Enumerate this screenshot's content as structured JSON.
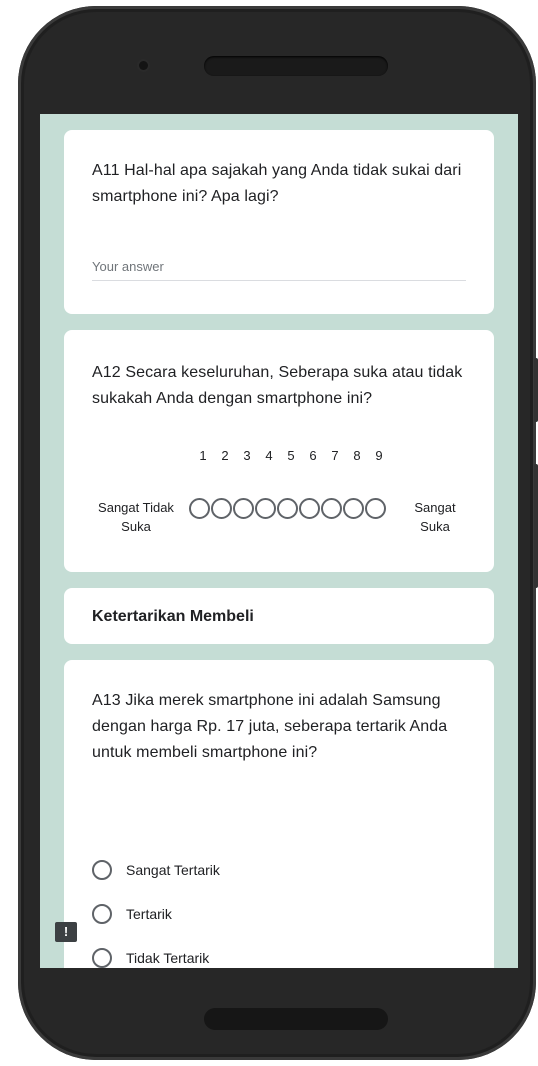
{
  "form": {
    "q11": {
      "title": "A11 Hal-hal apa sajakah yang Anda tidak sukai dari smartphone ini? Apa lagi?",
      "placeholder": "Your answer"
    },
    "q12": {
      "title": "A12 Secara keseluruhan, Seberapa suka atau tidak sukakah Anda dengan smartphone ini?",
      "scale": [
        "1",
        "2",
        "3",
        "4",
        "5",
        "6",
        "7",
        "8",
        "9"
      ],
      "low_label": "Sangat Tidak Suka",
      "high_label": "Sangat Suka"
    },
    "section": {
      "title": "Ketertarikan Membeli"
    },
    "q13": {
      "title": "A13 Jika merek smartphone ini adalah Samsung dengan harga Rp. 17 juta, seberapa tertarik Anda untuk membeli smartphone ini?",
      "options": [
        "Sangat Tertarik",
        "Tertarik",
        "Tidak Tertarik"
      ]
    }
  },
  "feedback_icon": {
    "glyph": "!",
    "name": "report-feedback-icon"
  },
  "colors": {
    "form_background": "#c5ddd5",
    "card": "#ffffff",
    "phone_body": "#1f1f1f"
  }
}
